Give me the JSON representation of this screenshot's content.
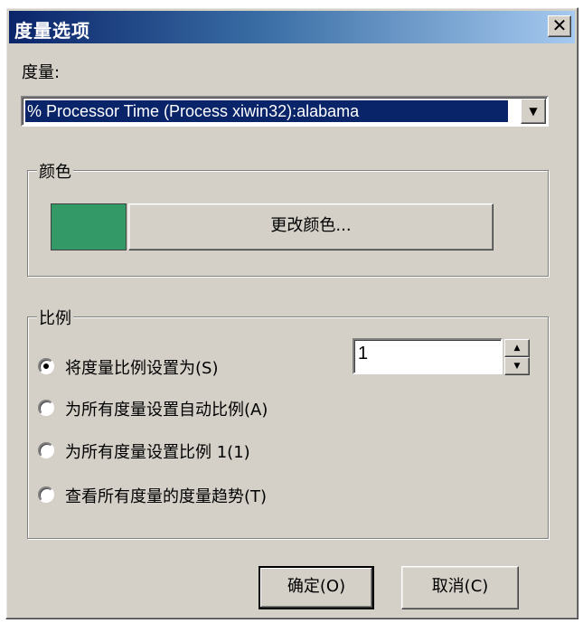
{
  "window": {
    "title": "度量选项",
    "close_label": "✕"
  },
  "measure": {
    "label": "度量:",
    "selected": "% Processor Time (Process xiwin32):alabama"
  },
  "color_group": {
    "legend": "颜色",
    "swatch_color": "#339966",
    "change_button": "更改颜色..."
  },
  "scale_group": {
    "legend": "比例",
    "options": [
      {
        "label": "将度量比例设置为(S)",
        "selected": true
      },
      {
        "label": "为所有度量设置自动比例(A)",
        "selected": false
      },
      {
        "label": "为所有度量设置比例 1(1)",
        "selected": false
      },
      {
        "label": "查看所有度量的度量趋势(T)",
        "selected": false
      }
    ],
    "scale_value": "1"
  },
  "buttons": {
    "ok": "确定(O)",
    "cancel": "取消(C)"
  }
}
